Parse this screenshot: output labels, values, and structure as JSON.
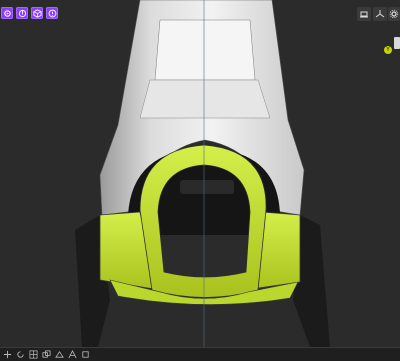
{
  "toolbar_left": {
    "buttons": [
      {
        "icon": "select-icon"
      },
      {
        "icon": "orbit-icon"
      },
      {
        "icon": "view-cube-icon"
      },
      {
        "icon": "info-icon"
      }
    ],
    "accent": "#8a3ffc"
  },
  "toolbar_right": {
    "buttons": [
      {
        "icon": "display-mode-icon"
      },
      {
        "icon": "axis-icon"
      },
      {
        "icon": "settings-gear-icon"
      }
    ]
  },
  "axis_badge": {
    "label": "Y",
    "color": "#c8d400"
  },
  "model": {
    "shell_color": "#e8e8e8",
    "highlight_color": "#c6e23a",
    "background": "#2b2b2b"
  },
  "bottom_bar": {
    "icons": [
      "move-icon",
      "rotate-icon",
      "grid-icon",
      "copy-icon",
      "measure-icon",
      "section-icon",
      "duplicate-icon"
    ]
  }
}
